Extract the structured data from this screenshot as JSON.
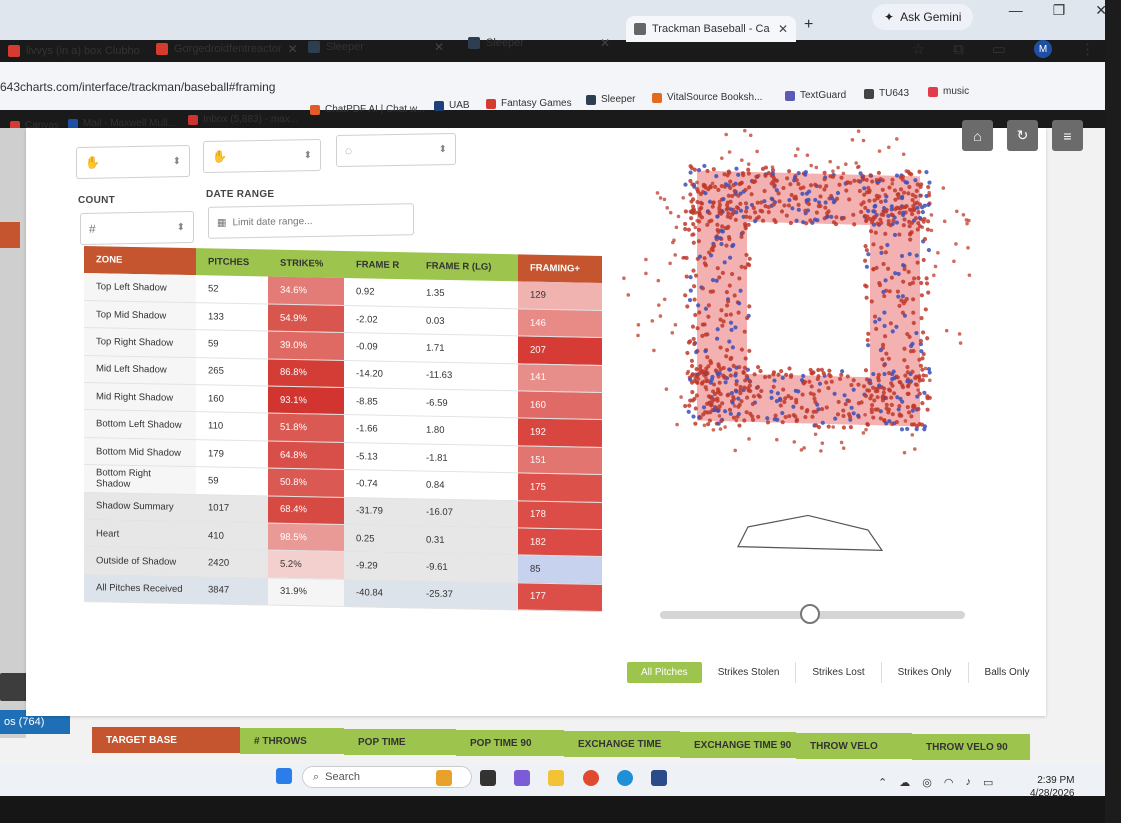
{
  "browser": {
    "tabs": [
      {
        "label": "livvys (in a) box Clubho",
        "icon_color": "#d63b2f"
      },
      {
        "label": "Gorgedroidfentreactor",
        "icon_color": "#d63b2f"
      },
      {
        "label": "Sleeper",
        "icon_color": "#2d3e50"
      },
      {
        "label": "Sleeper",
        "icon_color": "#2d3e50"
      },
      {
        "label": "Trackman Baseball - Ca",
        "icon_color": "#666666"
      }
    ],
    "new_tab": "+",
    "gemini_label": "Ask Gemini",
    "url": "643charts.com/interface/trackman/baseball#framing",
    "avatar_letter": "M",
    "bookmarks": [
      {
        "label": "Canvas",
        "color": "#d63b2f"
      },
      {
        "label": "Mail - Maxwell Mull...",
        "color": "#1f4fa3"
      },
      {
        "label": "Inbox (5,883) - max...",
        "color": "#c33"
      },
      {
        "label": "ChatPDF AI | Chat w...",
        "color": "#e25b2a"
      },
      {
        "label": "UAB",
        "color": "#1f3f7a"
      },
      {
        "label": "Fantasy Games",
        "color": "#d63b2f"
      },
      {
        "label": "Sleeper",
        "color": "#2d3e50"
      },
      {
        "label": "VitalSource Booksh...",
        "color": "#e56a1e"
      },
      {
        "label": "TextGuard",
        "color": "#5b5bb5"
      },
      {
        "label": "TU643",
        "color": "#444444"
      },
      {
        "label": "music",
        "color": "#e23b4a"
      }
    ]
  },
  "filters_top": {
    "count_label": "COUNT",
    "count_value": "#",
    "date_label": "DATE RANGE",
    "date_placeholder": "Limit date range..."
  },
  "table": {
    "headers": [
      "ZONE",
      "PITCHES",
      "STRIKE%",
      "FRAME R",
      "FRAME R (LG)",
      "FRAMING+"
    ],
    "rows": [
      {
        "zone": "Top Left Shadow",
        "pitches": "52",
        "strike": "34.6%",
        "frame_r": "0.92",
        "frame_r_lg": "1.35",
        "framing_plus": "129",
        "kind": "normal",
        "strike_color": "#e37b76",
        "plus_color": "#f0b3b0"
      },
      {
        "zone": "Top Mid Shadow",
        "pitches": "133",
        "strike": "54.9%",
        "frame_r": "-2.02",
        "frame_r_lg": "0.03",
        "framing_plus": "146",
        "kind": "normal",
        "strike_color": "#d9564f",
        "plus_color": "#e88a86"
      },
      {
        "zone": "Top Right Shadow",
        "pitches": "59",
        "strike": "39.0%",
        "frame_r": "-0.09",
        "frame_r_lg": "1.71",
        "framing_plus": "207",
        "kind": "normal",
        "strike_color": "#df6a64",
        "plus_color": "#d63b35"
      },
      {
        "zone": "Mid Left Shadow",
        "pitches": "265",
        "strike": "86.8%",
        "frame_r": "-14.20",
        "frame_r_lg": "-11.63",
        "framing_plus": "141",
        "kind": "normal",
        "strike_color": "#d43c36",
        "plus_color": "#e78e8a"
      },
      {
        "zone": "Mid Right Shadow",
        "pitches": "160",
        "strike": "93.1%",
        "frame_r": "-8.85",
        "frame_r_lg": "-6.59",
        "framing_plus": "160",
        "kind": "normal",
        "strike_color": "#d2352f",
        "plus_color": "#e06a65"
      },
      {
        "zone": "Bottom Left Shadow",
        "pitches": "110",
        "strike": "51.8%",
        "frame_r": "-1.66",
        "frame_r_lg": "1.80",
        "framing_plus": "192",
        "kind": "normal",
        "strike_color": "#da5a53",
        "plus_color": "#d94640"
      },
      {
        "zone": "Bottom Mid Shadow",
        "pitches": "179",
        "strike": "64.8%",
        "frame_r": "-5.13",
        "frame_r_lg": "-1.81",
        "framing_plus": "151",
        "kind": "normal",
        "strike_color": "#d84e48",
        "plus_color": "#e37571"
      },
      {
        "zone": "Bottom Right Shadow",
        "pitches": "59",
        "strike": "50.8%",
        "frame_r": "-0.74",
        "frame_r_lg": "0.84",
        "framing_plus": "175",
        "kind": "normal",
        "strike_color": "#da5953",
        "plus_color": "#dd514b"
      },
      {
        "zone": "Shadow Summary",
        "pitches": "1017",
        "strike": "68.4%",
        "frame_r": "-31.79",
        "frame_r_lg": "-16.07",
        "framing_plus": "178",
        "kind": "summary",
        "strike_color": "#d74943",
        "plus_color": "#dc4d47"
      },
      {
        "zone": "Heart",
        "pitches": "410",
        "strike": "98.5%",
        "frame_r": "0.25",
        "frame_r_lg": "0.31",
        "framing_plus": "182",
        "kind": "summary",
        "strike_color": "#e99a96",
        "plus_color": "#db4a44"
      },
      {
        "zone": "Outside of Shadow",
        "pitches": "2420",
        "strike": "5.2%",
        "frame_r": "-9.29",
        "frame_r_lg": "-9.61",
        "framing_plus": "85",
        "kind": "summary",
        "strike_color": "#f3cfcd",
        "plus_color": "#c7d2ee"
      },
      {
        "zone": "All Pitches Received",
        "pitches": "3847",
        "strike": "31.9%",
        "frame_r": "-40.84",
        "frame_r_lg": "-25.37",
        "framing_plus": "177",
        "kind": "total",
        "strike_color": "#f5f5f5",
        "plus_color": "#dc4f49"
      }
    ]
  },
  "plot": {
    "strike_color": "#c0392b",
    "ball_color": "#3b4fb8",
    "shadow_color": "#f2a3a3"
  },
  "pitch_filters": [
    "All Pitches",
    "Strikes Stolen",
    "Strikes Lost",
    "Strikes Only",
    "Balls Only"
  ],
  "bottom_table": {
    "headers": [
      "TARGET BASE",
      "# THROWS",
      "POP TIME",
      "POP TIME 90",
      "EXCHANGE TIME",
      "EXCHANGE TIME 90",
      "THROW VELO",
      "THROW VELO 90"
    ]
  },
  "left_panel": {
    "badge": "os (764)"
  },
  "taskbar": {
    "search_placeholder": "Search",
    "time": "2:39 PM",
    "date": "4/28/2026"
  }
}
